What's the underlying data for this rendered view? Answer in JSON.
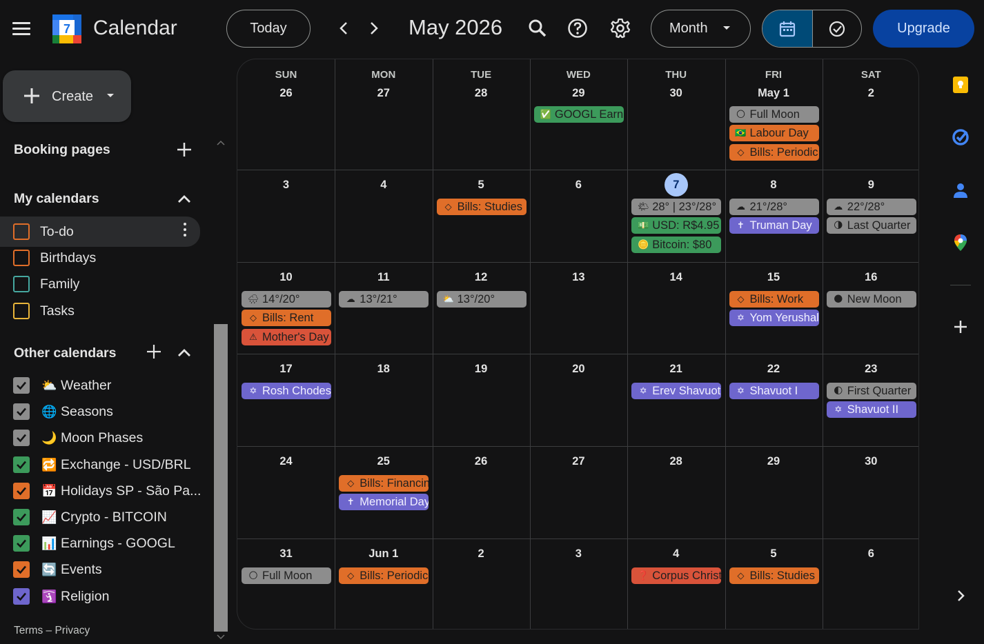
{
  "app": {
    "title": "Calendar",
    "logo_number": "7"
  },
  "header": {
    "today_label": "Today",
    "month_title": "May 2026",
    "view_label": "Month",
    "upgrade_label": "Upgrade"
  },
  "sidebar": {
    "create_label": "Create",
    "booking_pages": "Booking pages",
    "my_calendars_title": "My calendars",
    "my_calendars": [
      {
        "name": "To-do",
        "color": "#e06e29",
        "checked": false
      },
      {
        "name": "Birthdays",
        "color": "#e06e29",
        "checked": false
      },
      {
        "name": "Family",
        "color": "#46a8a0",
        "checked": false
      },
      {
        "name": "Tasks",
        "color": "#e9b53a",
        "checked": false
      }
    ],
    "other_calendars_title": "Other calendars",
    "other_calendars": [
      {
        "name": "Weather",
        "icon": "⛅",
        "color": "#8d8d8d"
      },
      {
        "name": "Seasons",
        "icon": "🌐",
        "color": "#8d8d8d"
      },
      {
        "name": "Moon Phases",
        "icon": "🌙",
        "color": "#8d8d8d"
      },
      {
        "name": "Exchange - USD/BRL",
        "icon": "🔁",
        "color": "#3c9a5b"
      },
      {
        "name": "Holidays SP - São Pa...",
        "icon": "📅",
        "color": "#e06e29"
      },
      {
        "name": "Crypto - BITCOIN",
        "icon": "📈",
        "color": "#3c9a5b"
      },
      {
        "name": "Earnings - GOOGL",
        "icon": "📊",
        "color": "#3c9a5b"
      },
      {
        "name": "Events",
        "icon": "🔄",
        "color": "#e06e29"
      },
      {
        "name": "Religion",
        "icon": "🛐",
        "color": "#6e66cd"
      }
    ],
    "footer_terms": "Terms",
    "footer_sep": " – ",
    "footer_privacy": "Privacy"
  },
  "grid": {
    "weekdays": [
      "SUN",
      "MON",
      "TUE",
      "WED",
      "THU",
      "FRI",
      "SAT"
    ],
    "weeks": [
      [
        "26",
        "27",
        "28",
        "29",
        "30",
        "May 1",
        "2"
      ],
      [
        "3",
        "4",
        "5",
        "6",
        "7",
        "8",
        "9"
      ],
      [
        "10",
        "11",
        "12",
        "13",
        "14",
        "15",
        "16"
      ],
      [
        "17",
        "18",
        "19",
        "20",
        "21",
        "22",
        "23"
      ],
      [
        "24",
        "25",
        "26",
        "27",
        "28",
        "29",
        "30"
      ],
      [
        "31",
        "Jun 1",
        "2",
        "3",
        "4",
        "5",
        "6"
      ]
    ],
    "events": [
      {
        "week": 0,
        "day": 3,
        "slot": 0,
        "label": "GOOGL Earnings",
        "color": "green",
        "icon": "✅"
      },
      {
        "week": 0,
        "day": 5,
        "slot": 0,
        "label": "Full Moon",
        "color": "gray",
        "icon": "🌕"
      },
      {
        "week": 0,
        "day": 5,
        "slot": 1,
        "label": "Labour Day",
        "color": "orange",
        "icon": "🇧🇷"
      },
      {
        "week": 0,
        "day": 5,
        "slot": 2,
        "label": "Bills: Periodic",
        "color": "orange",
        "icon": "◇"
      },
      {
        "week": 1,
        "day": 2,
        "slot": 0,
        "label": "Bills: Studies",
        "color": "orange",
        "icon": "◇"
      },
      {
        "week": 1,
        "day": 4,
        "slot": 0,
        "label": "28° | 23°/28°",
        "color": "gray",
        "icon": "🌤"
      },
      {
        "week": 1,
        "day": 4,
        "slot": 1,
        "label": "USD: R$4.95",
        "color": "green",
        "icon": "💵"
      },
      {
        "week": 1,
        "day": 4,
        "slot": 2,
        "label": "Bitcoin: $80",
        "color": "green",
        "icon": "🪙"
      },
      {
        "week": 1,
        "day": 5,
        "slot": 0,
        "label": "21°/28°",
        "color": "gray",
        "icon": "☁"
      },
      {
        "week": 1,
        "day": 5,
        "slot": 1,
        "label": "Truman Day",
        "color": "purple",
        "icon": "✝"
      },
      {
        "week": 1,
        "day": 6,
        "slot": 0,
        "label": "22°/28°",
        "color": "gray",
        "icon": "☁"
      },
      {
        "week": 1,
        "day": 6,
        "slot": 1,
        "label": "Last Quarter",
        "color": "gray",
        "icon": "🌗"
      },
      {
        "week": 2,
        "day": 0,
        "slot": 0,
        "label": "14°/20°",
        "color": "gray",
        "icon": "🌧"
      },
      {
        "week": 2,
        "day": 0,
        "slot": 1,
        "label": "Bills: Rent",
        "color": "orange",
        "icon": "◇"
      },
      {
        "week": 2,
        "day": 0,
        "slot": 2,
        "label": "Mother's Day",
        "color": "red",
        "icon": "⚠"
      },
      {
        "week": 2,
        "day": 1,
        "slot": 0,
        "label": "13°/21°",
        "color": "gray",
        "icon": "☁"
      },
      {
        "week": 2,
        "day": 2,
        "slot": 0,
        "label": "13°/20°",
        "color": "gray",
        "icon": "⛅"
      },
      {
        "week": 2,
        "day": 5,
        "slot": 0,
        "label": "Bills: Work",
        "color": "orange",
        "icon": "◇"
      },
      {
        "week": 2,
        "day": 5,
        "slot": 1,
        "label": "Yom Yerushalayim",
        "color": "purple",
        "icon": "✡"
      },
      {
        "week": 2,
        "day": 6,
        "slot": 0,
        "label": "New Moon",
        "color": "gray",
        "icon": "🌑"
      },
      {
        "week": 3,
        "day": 0,
        "slot": 0,
        "label": "Rosh Chodesh",
        "color": "purple",
        "icon": "✡"
      },
      {
        "week": 3,
        "day": 4,
        "slot": 0,
        "label": "Erev Shavuot",
        "color": "purple",
        "icon": "✡"
      },
      {
        "week": 3,
        "day": 5,
        "slot": 0,
        "label": "Shavuot I",
        "color": "purple",
        "icon": "✡"
      },
      {
        "week": 3,
        "day": 6,
        "slot": 0,
        "label": "First Quarter",
        "color": "gray",
        "icon": "🌓"
      },
      {
        "week": 3,
        "day": 6,
        "slot": 1,
        "label": "Shavuot II",
        "color": "purple",
        "icon": "✡"
      },
      {
        "week": 4,
        "day": 1,
        "slot": 0,
        "label": "Bills: Financing",
        "color": "orange",
        "icon": "◇"
      },
      {
        "week": 4,
        "day": 1,
        "slot": 1,
        "label": "Memorial Day",
        "color": "purple",
        "icon": "✝"
      },
      {
        "week": 5,
        "day": 0,
        "slot": 0,
        "label": "Full Moon",
        "color": "gray",
        "icon": "🌕"
      },
      {
        "week": 5,
        "day": 1,
        "slot": 0,
        "label": "Bills: Periodic",
        "color": "orange",
        "icon": "◇"
      },
      {
        "week": 5,
        "day": 4,
        "slot": 0,
        "label": "Corpus Christi",
        "color": "red",
        "icon": "❓"
      },
      {
        "week": 5,
        "day": 5,
        "slot": 0,
        "label": "Bills: Studies",
        "color": "orange",
        "icon": "◇"
      }
    ]
  },
  "colors": {
    "background": "#131314",
    "accent": "#a8c7fa",
    "upgrade": "#0842a0",
    "chip_gray": "#8d8d8d",
    "chip_orange": "#e06e29",
    "chip_green": "#3c9a5b",
    "chip_purple": "#6e66cd",
    "chip_red": "#d9533a"
  }
}
